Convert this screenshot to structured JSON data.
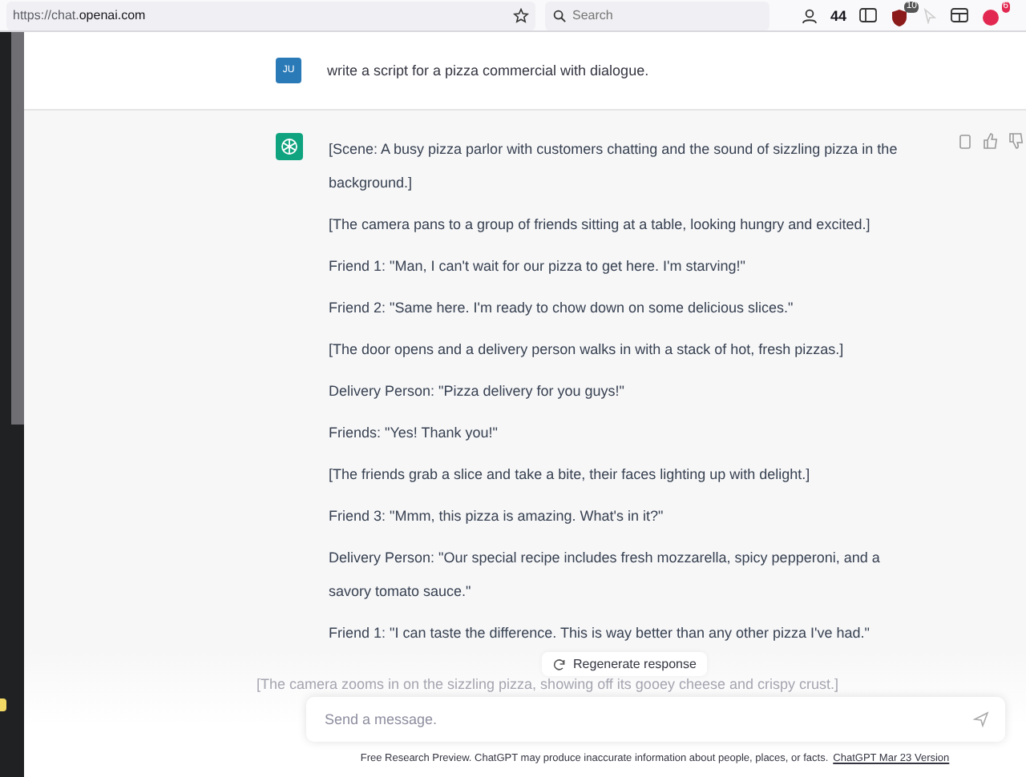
{
  "browser": {
    "url_host": "https://chat.",
    "url_domain": "openai.com",
    "search": {
      "placeholder": "Search"
    },
    "toolbar_count": "44",
    "badges": [
      "10",
      "6"
    ]
  },
  "conversation": {
    "user": {
      "avatar": "JU",
      "message": "write a script for a pizza commercial with dialogue."
    },
    "assistant": {
      "paragraphs": [
        "[Scene: A busy pizza parlor with customers chatting and the sound of sizzling pizza in the background.]",
        "[The camera pans to a group of friends sitting at a table, looking hungry and excited.]",
        "Friend 1: \"Man, I can't wait for our pizza to get here. I'm starving!\"",
        "Friend 2: \"Same here. I'm ready to chow down on some delicious slices.\"",
        "[The door opens and a delivery person walks in with a stack of hot, fresh pizzas.]",
        "Delivery Person: \"Pizza delivery for you guys!\"",
        "Friends: \"Yes! Thank you!\"",
        "[The friends grab a slice and take a bite, their faces lighting up with delight.]",
        "Friend 3: \"Mmm, this pizza is amazing. What's in it?\"",
        "Delivery Person: \"Our special recipe includes fresh mozzarella, spicy pepperoni, and a savory tomato sauce.\"",
        "Friend 1: \"I can taste the difference. This is way better than any other pizza I've had.\"",
        "[The camera zooms in on the sizzling pizza, showing off its gooey cheese and crispy crust.]"
      ]
    }
  },
  "regenerate_button": "Regenerate response",
  "composer": {
    "placeholder": "Send a message."
  },
  "footer": {
    "text": "Free Research Preview. ChatGPT may produce inaccurate information about people, places, or facts.",
    "link": "ChatGPT Mar 23 Version"
  }
}
